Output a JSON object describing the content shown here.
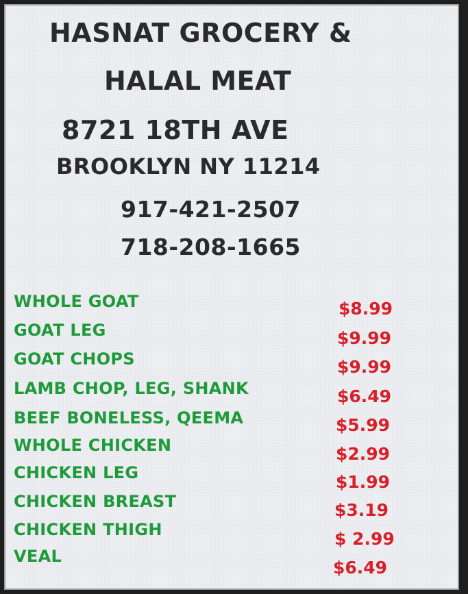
{
  "header": {
    "line1": "HASNAT GROCERY &",
    "line2": "HALAL MEAT",
    "address": "8721 18TH AVE",
    "city": "BROOKLYN NY 11214",
    "phone1": "917-421-2507",
    "phone2": "718-208-1665"
  },
  "menu": {
    "items": [
      {
        "name": "WHOLE GOAT",
        "price": "$8.99"
      },
      {
        "name": "GOAT LEG",
        "price": "$9.99"
      },
      {
        "name": "GOAT CHOPS",
        "price": "$9.99"
      },
      {
        "name": "LAMB CHOP, LEG, SHANK",
        "price": "$6.49"
      },
      {
        "name": "BEEF BONELESS, QEEMA",
        "price": "$5.99"
      },
      {
        "name": "WHOLE CHICKEN",
        "price": "$2.99"
      },
      {
        "name": "CHICKEN LEG",
        "price": "$1.99"
      },
      {
        "name": "CHICKEN BREAST",
        "price": "$3.19"
      },
      {
        "name": "CHICKEN THIGH",
        "price": "$ 2.99"
      },
      {
        "name": "VEAL",
        "price": "$6.49"
      }
    ]
  },
  "colors": {
    "item_text": "#1f9a3a",
    "price_text": "#d8202a",
    "header_text": "#2a2a2a"
  }
}
